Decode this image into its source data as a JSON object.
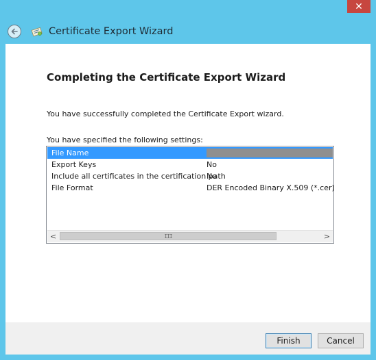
{
  "window": {
    "title": "Certificate Export Wizard",
    "close_label": "✕"
  },
  "main": {
    "heading": "Completing the Certificate Export Wizard",
    "success_text": "You have successfully completed the Certificate Export wizard.",
    "settings_label": "You have specified the following settings:"
  },
  "settings": [
    {
      "name": "File Name",
      "value": ""
    },
    {
      "name": "Export Keys",
      "value": "No"
    },
    {
      "name": "Include all certificates in the certification path",
      "value": "No"
    },
    {
      "name": "File Format",
      "value": "DER Encoded Binary X.509 (*.cer)"
    }
  ],
  "scrollbar": {
    "left_arrow": "<",
    "right_arrow": ">",
    "grip": "III"
  },
  "footer": {
    "finish_label": "Finish",
    "cancel_label": "Cancel"
  },
  "colors": {
    "frame": "#5ec6ea",
    "selection": "#3399ff",
    "close": "#c7463f"
  }
}
